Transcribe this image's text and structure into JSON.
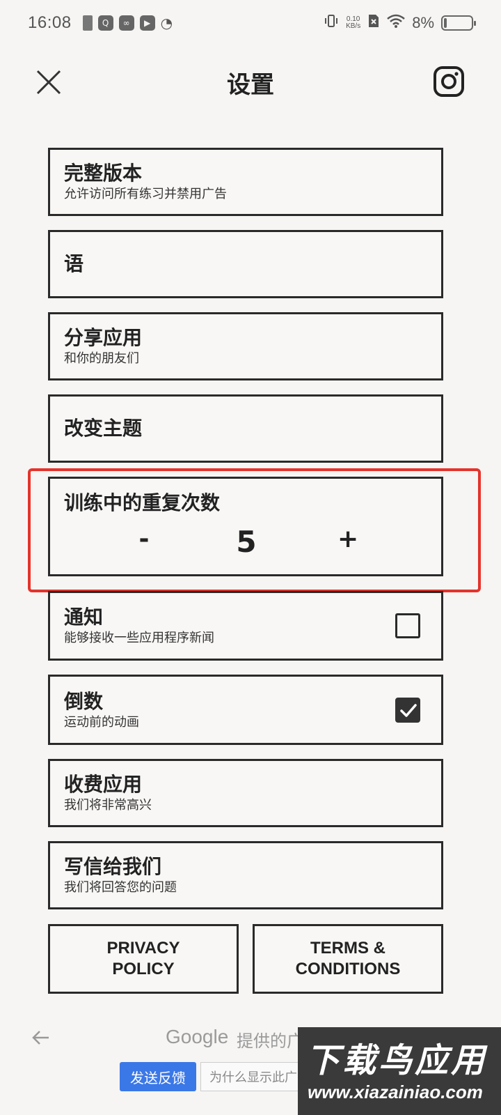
{
  "status_bar": {
    "time": "16:08",
    "net_speed_value": "0.10",
    "net_speed_unit": "KB/s",
    "battery_percent": "8%"
  },
  "header": {
    "title": "设置"
  },
  "settings": {
    "full_version": {
      "title": "完整版本",
      "subtitle": "允许访问所有练习并禁用广告"
    },
    "language": {
      "title": "语"
    },
    "share_app": {
      "title": "分享应用",
      "subtitle": "和你的朋友们"
    },
    "change_theme": {
      "title": "改变主题"
    },
    "reps": {
      "title": "训练中的重复次数",
      "minus": "-",
      "value": "5",
      "plus": "+"
    },
    "notifications": {
      "title": "通知",
      "subtitle": "能够接收一些应用程序新闻",
      "checked": false
    },
    "countdown": {
      "title": "倒数",
      "subtitle": "运动前的动画",
      "checked": true
    },
    "paid_app": {
      "title": "收费应用",
      "subtitle": "我们将非常高兴"
    },
    "write_us": {
      "title": "写信给我们",
      "subtitle": "我们将回答您的问题"
    }
  },
  "footer_buttons": {
    "privacy_line1": "PRIVACY",
    "privacy_line2": "POLICY",
    "terms_line1": "TERMS &",
    "terms_line2": "CONDITIONS"
  },
  "ad": {
    "brand": "Google",
    "provided_text": "提供的广告",
    "feedback_label": "发送反馈",
    "why_label": "为什么显示此广告？"
  },
  "watermark": {
    "title": "下载鸟应用",
    "url": "www.xiazainiao.com"
  },
  "colors": {
    "background": "#f6f5f3",
    "border": "#2a2a2a",
    "highlight": "#e4332b",
    "feedback_button": "#3b78e7"
  }
}
